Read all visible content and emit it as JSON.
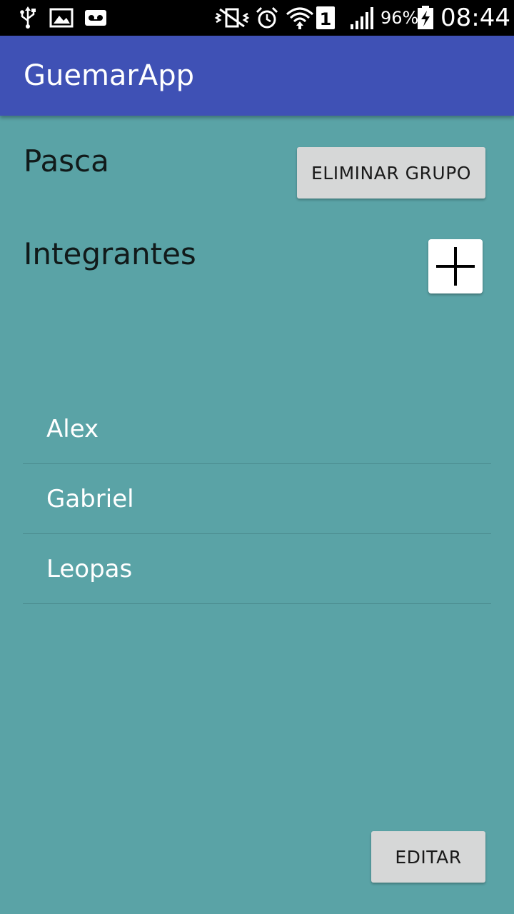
{
  "status_bar": {
    "icons": [
      "usb-icon",
      "image-icon",
      "voicemail-icon",
      "vibrate-mute-icon",
      "alarm-icon",
      "wifi-icon",
      "sim-1-icon",
      "signal-icon",
      "battery-charging-icon"
    ],
    "sim_slot": "1",
    "battery_percent": "96%",
    "time": "08:44"
  },
  "app_bar": {
    "title": "GuemarApp",
    "color": "#3f51b5"
  },
  "group": {
    "name": "Pasca",
    "delete_label": "ELIMINAR GRUPO"
  },
  "members": {
    "title": "Integrantes",
    "add_icon": "plus-icon",
    "items": [
      {
        "label": "Alex"
      },
      {
        "label": "Gabriel"
      },
      {
        "label": "Leopas"
      }
    ]
  },
  "footer": {
    "edit_label": "EDITAR"
  },
  "colors": {
    "background": "#5aa3a6",
    "button": "#d6d7d7"
  }
}
